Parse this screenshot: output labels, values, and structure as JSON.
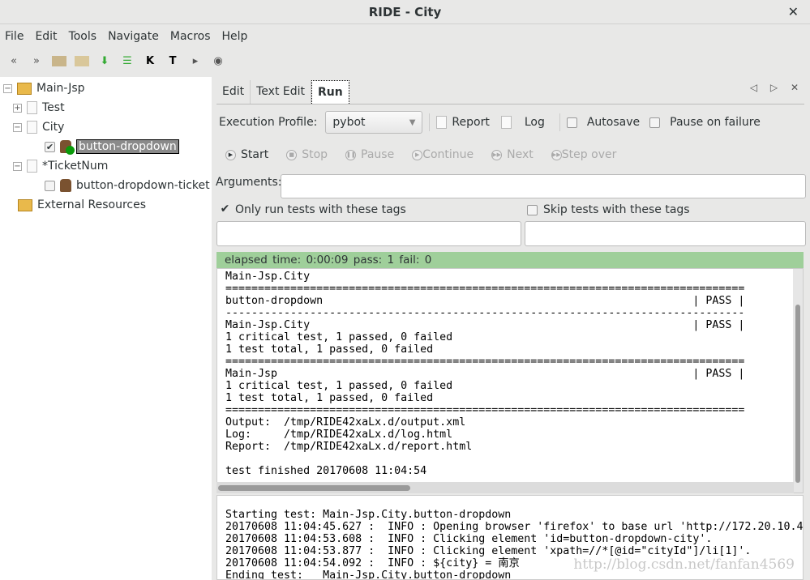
{
  "window": {
    "title": "RIDE - City",
    "close": "✕"
  },
  "menu": [
    "File",
    "Edit",
    "Tools",
    "Navigate",
    "Macros",
    "Help"
  ],
  "toolbar": [
    "back-icon",
    "forward-icon",
    "open-folder-icon",
    "folder-icon",
    "import-icon",
    "library-icon",
    "search-keywords-icon",
    "search-tests-icon",
    "run-icon",
    "stop-icon"
  ],
  "tree": {
    "root": "Main-Jsp",
    "test": "Test",
    "city": "City",
    "case1": "button-dropdown",
    "ticket": "*TicketNum",
    "case2": "button-dropdown-ticket",
    "external": "External Resources"
  },
  "tabs": {
    "edit": "Edit",
    "text_edit": "Text Edit",
    "run": "Run",
    "nav": "◁ ▷ ✕"
  },
  "run": {
    "profile_label": "Execution Profile:",
    "profile": "pybot",
    "report": "Report",
    "log": "Log",
    "autosave": "Autosave",
    "pause_on_failure": "Pause on failure",
    "start": "Start",
    "stop": "Stop",
    "pause": "Pause",
    "continue": "Continue",
    "next": "Next",
    "step_over": "Step over",
    "arguments_label": "Arguments:",
    "arguments": "",
    "only_tags": "Only run tests with these tags",
    "skip_tags": "Skip tests with these tags",
    "only_tags_checked": true,
    "skip_tags_checked": false
  },
  "status": {
    "text": "elapsed time: 0:00:09    pass: 1    fail: 0",
    "color": "#9fcf9a"
  },
  "output": "Main-Jsp.City\n================================================================================\nbutton-dropdown                                                         | PASS |\n--------------------------------------------------------------------------------\nMain-Jsp.City                                                           | PASS |\n1 critical test, 1 passed, 0 failed\n1 test total, 1 passed, 0 failed\n================================================================================\nMain-Jsp                                                                | PASS |\n1 critical test, 1 passed, 0 failed\n1 test total, 1 passed, 0 failed\n================================================================================\nOutput:  /tmp/RIDE42xaLx.d/output.xml\nLog:     /tmp/RIDE42xaLx.d/log.html\nReport:  /tmp/RIDE42xaLx.d/report.html\n\ntest finished 20170608 11:04:54",
  "log": "Starting test: Main-Jsp.City.button-dropdown\n20170608 11:04:45.627 :  INFO : Opening browser 'firefox' to base url 'http://172.20.10.4\n20170608 11:04:53.608 :  INFO : Clicking element 'id=button-dropdown-city'.\n20170608 11:04:53.877 :  INFO : Clicking element 'xpath=//*[@id=\"cityId\"]/li[1]'.\n20170608 11:04:54.092 :  INFO : ${city} = 南京\nEnding test:   Main-Jsp.City.button-dropdown",
  "watermark": "http://blog.csdn.net/fanfan4569"
}
